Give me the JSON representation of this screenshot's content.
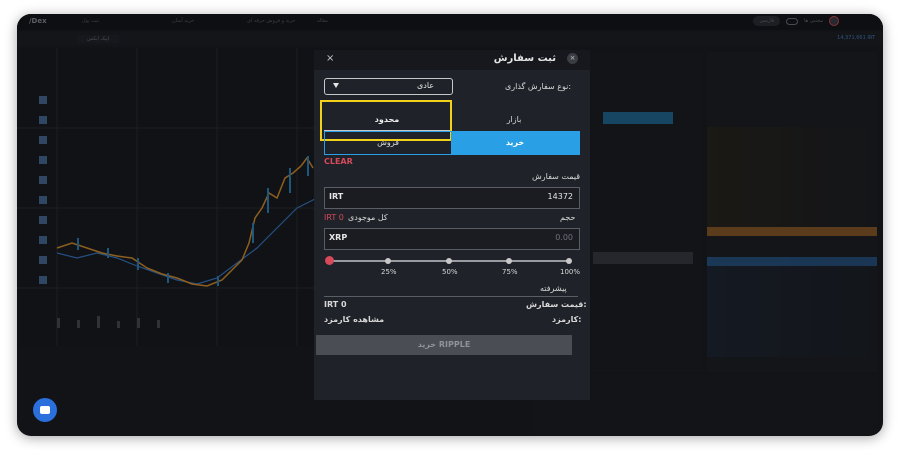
{
  "topbar": {
    "logo": "/Dex",
    "nav": [
      "ثبت پول",
      "خرید آسان",
      "خرید و فروش حرفه ای",
      "مقاله"
    ],
    "user": "مجتبی ها",
    "lang": "فارسی"
  },
  "subbar": {
    "symbol": "اپیک ایکس",
    "pair": "14,371,661 IRT"
  },
  "modal": {
    "title": "ثبت سفارش",
    "close_icon": "×",
    "order_type_label": "نوع سفارش گذاری:",
    "order_type_value": "عادی",
    "tabs": {
      "limit": "محدود",
      "market": "بازار"
    },
    "sides": {
      "buy": "خرید",
      "sell": "فروش"
    },
    "clear": "CLEAR",
    "price_label": "قیمت سفارش",
    "price_unit": "IRT",
    "price_value": "14372",
    "volume_label": "حجم",
    "balance_label": "کل موجودی",
    "balance_value": "IRT 0",
    "volume_unit": "XRP",
    "volume_placeholder": "0.00",
    "percent_marks": [
      "25%",
      "50%",
      "75%",
      "100%"
    ],
    "advanced_label": "پیشرفته",
    "order_price_label": "قیمت سفارش:",
    "order_price_value": "IRT 0",
    "fee_label": "کارمزد:",
    "fee_value": "مشاهده کارمزد",
    "submit_label": "خرید RIPPLE"
  },
  "colors": {
    "buy": "#29a0e5",
    "highlight": "#f2d11b",
    "clear": "#d64a5a"
  }
}
